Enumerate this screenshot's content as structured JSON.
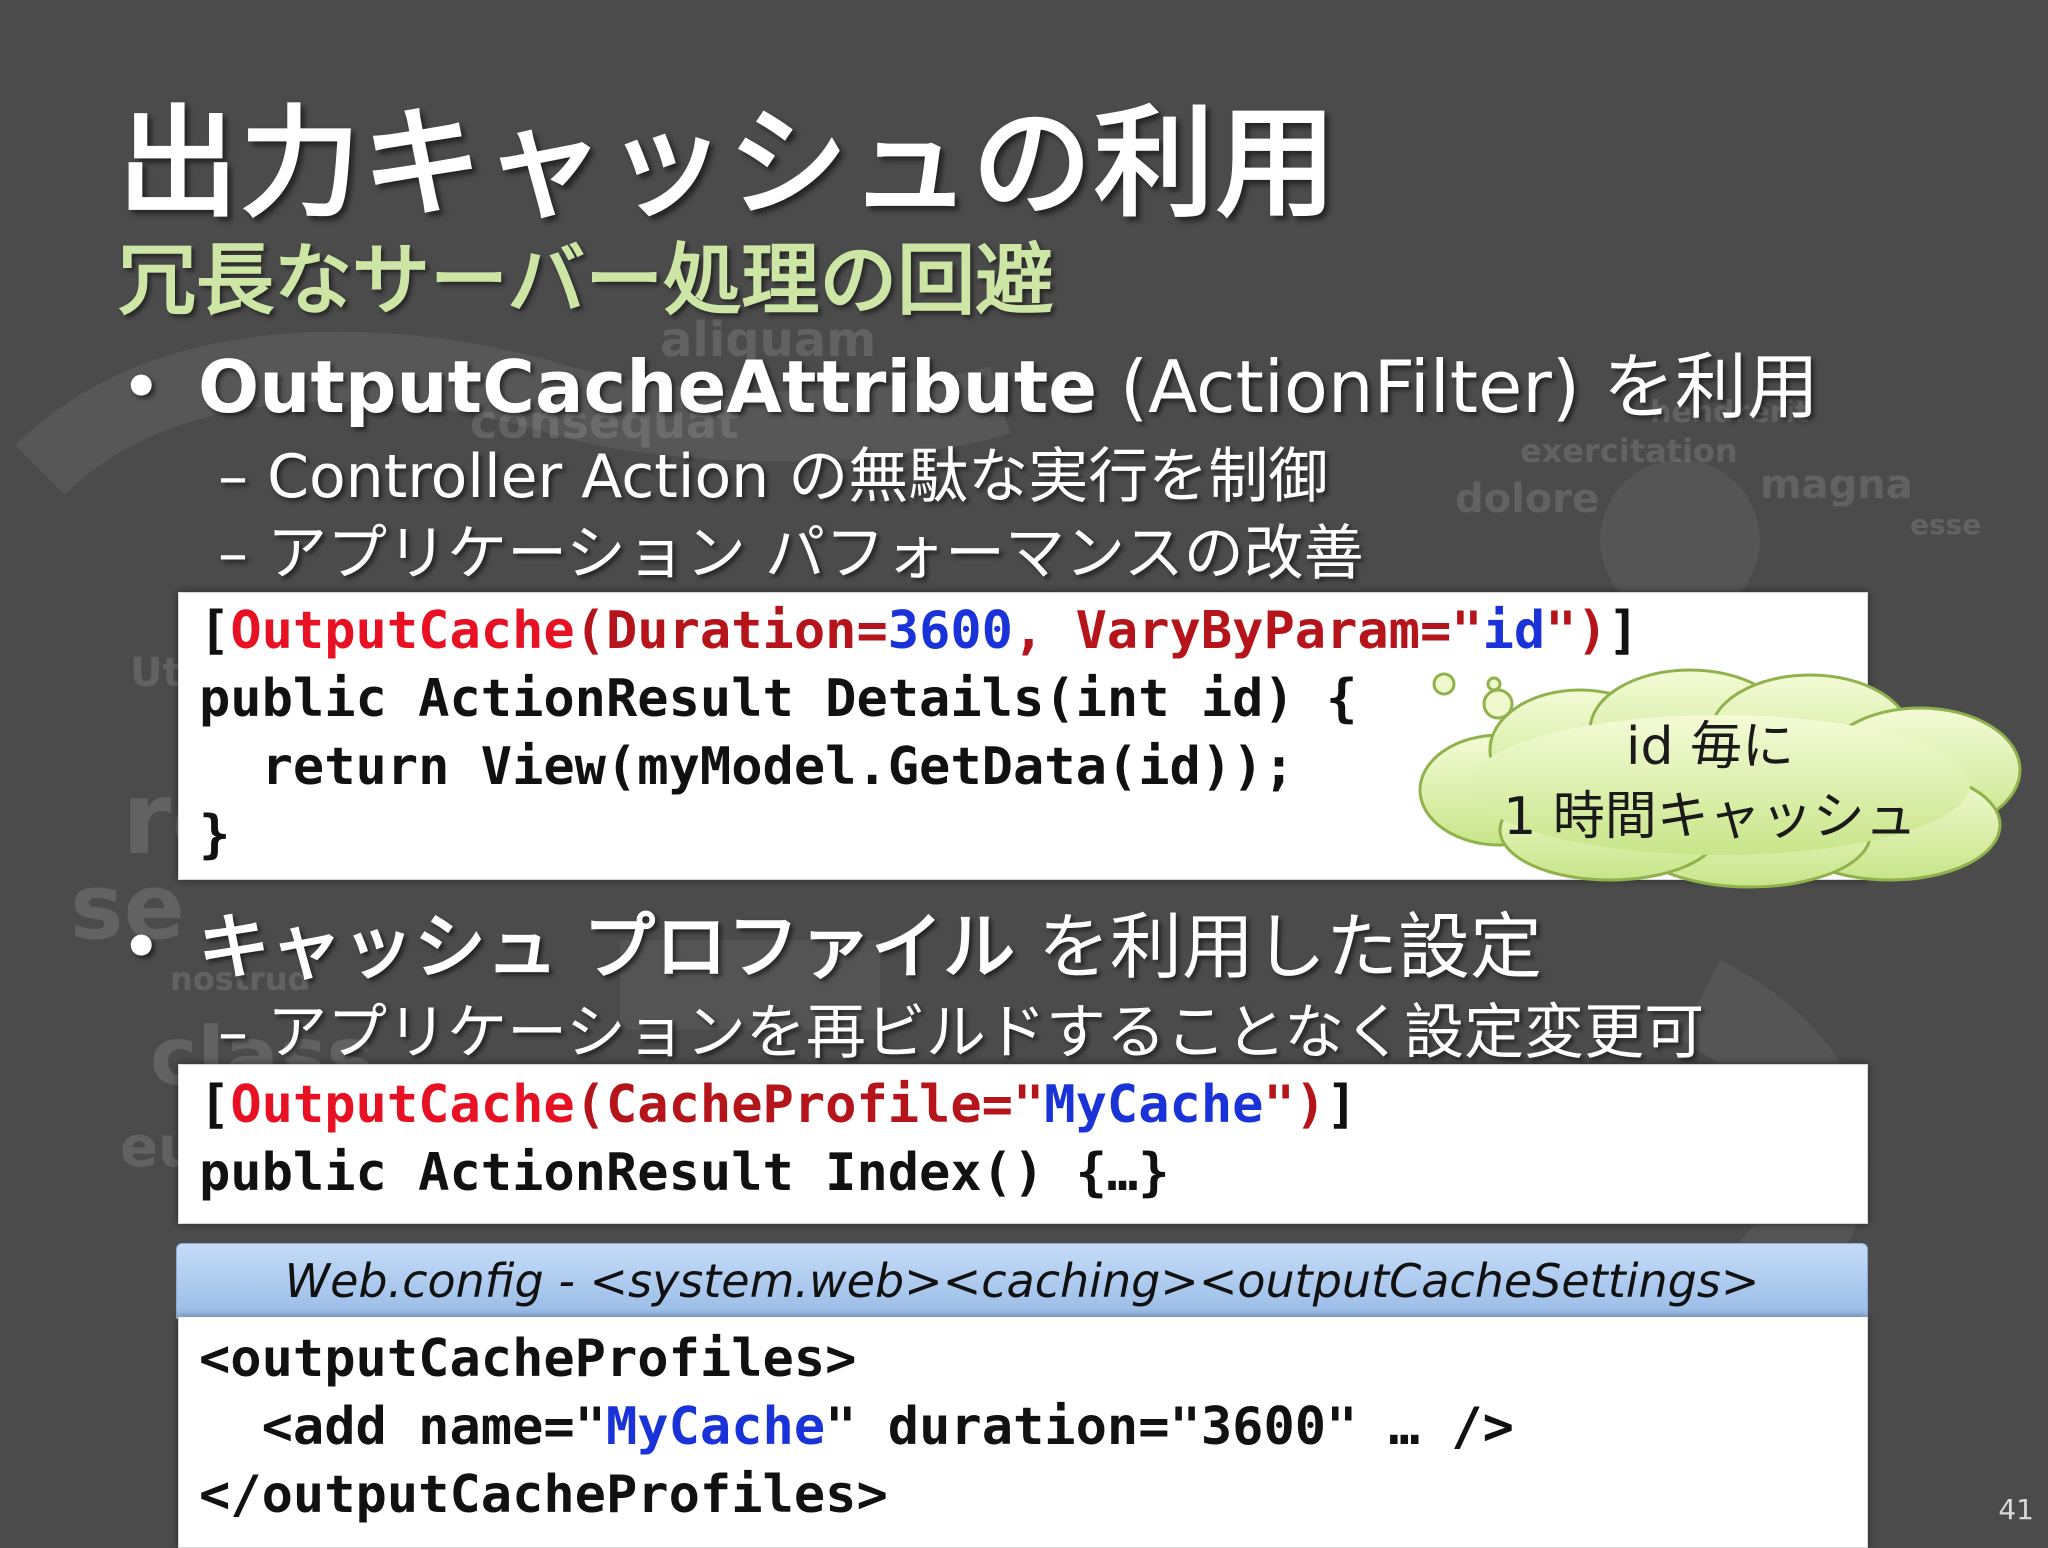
{
  "slide": {
    "title": "出力キャッシュの利用",
    "subtitle": "冗長なサーバー処理の回避",
    "bullet1": {
      "bold": "OutputCacheAttribute",
      "rest": " (ActionFilter) を利用"
    },
    "bullet1_subs": [
      "– Controller Action の無駄な実行を制御",
      "– アプリケーション パフォーマンスの改善"
    ],
    "code1": {
      "line1": {
        "open": "[",
        "attr": "OutputCache",
        "p1": "(Duration=",
        "num": "3600",
        "p2": ", VaryByParam=\"",
        "id": "id",
        "p3": "\")",
        "close": "]"
      },
      "line2": "public ActionResult Details(int id) {",
      "line3": "  return View(myModel.GetData(id));",
      "line4": "}"
    },
    "callout": {
      "line1": "id 毎に",
      "line2": "1 時間キャッシュ"
    },
    "bullet2": {
      "bold": "キャッシュ プロファイル",
      "rest": " を利用した設定"
    },
    "bullet2_sub": "– アプリケーションを再ビルドすることなく設定変更可",
    "code2": {
      "line1": {
        "open": "[",
        "attr": "OutputCache",
        "p1": "(CacheProfile=\"",
        "name": "MyCache",
        "p2": "\")",
        "close": "]"
      },
      "line2": "public ActionResult Index() {…}"
    },
    "config_header": "Web.config - <system.web><caching><outputCacheSettings>",
    "code3": {
      "line1": "<outputCacheProfiles>",
      "line2": {
        "a": "  <add name=\"",
        "name": "MyCache",
        "b": "\" duration=\"3600\" … />"
      },
      "line3": "</outputCacheProfiles>"
    },
    "page_number": "41"
  },
  "background_words": [
    "aliquam",
    "consequat",
    "exercitation",
    "magna",
    "dolore",
    "esse",
    "hendrerit",
    "nostrud",
    "class",
    "eu",
    "Ut",
    "re",
    "se"
  ],
  "colors": {
    "background": "#4b4b4b",
    "subtitle": "#cde6a6",
    "keyword": "#e81123",
    "string": "#b4141a",
    "value": "#1a33d8"
  }
}
